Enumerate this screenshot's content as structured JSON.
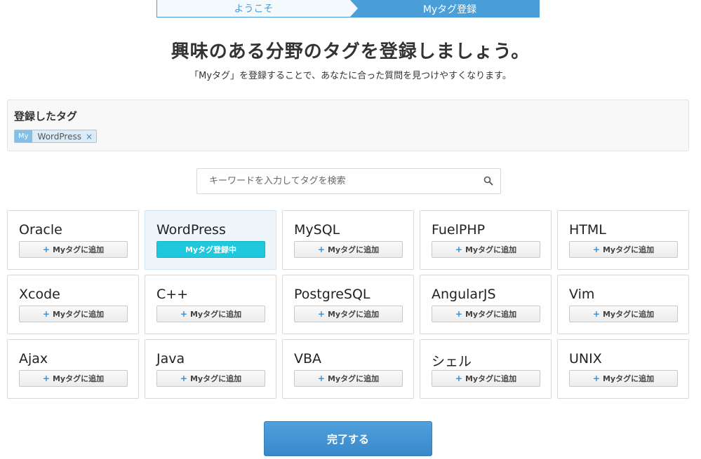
{
  "stepper": {
    "steps": [
      {
        "label": "ようこそ",
        "state": "done"
      },
      {
        "label": "Myタグ登録",
        "state": "current"
      }
    ]
  },
  "header": {
    "title": "興味のある分野のタグを登録しましょう。",
    "subtitle": "「Myタグ」を登録することで、あなたに合った質問を見つけやすくなります。"
  },
  "registered_tags": {
    "title": "登録したタグ",
    "items": [
      {
        "prefix": "My",
        "label": "WordPress",
        "remove": "×"
      }
    ]
  },
  "search": {
    "placeholder": "キーワードを入力してタグを検索",
    "value": "",
    "icon": "search-icon"
  },
  "tags": [
    {
      "name": "Oracle",
      "button": "Myタグに追加",
      "registered": false
    },
    {
      "name": "WordPress",
      "button": "Myタグ登録中",
      "registered": true
    },
    {
      "name": "MySQL",
      "button": "Myタグに追加",
      "registered": false
    },
    {
      "name": "FuelPHP",
      "button": "Myタグに追加",
      "registered": false
    },
    {
      "name": "HTML",
      "button": "Myタグに追加",
      "registered": false
    },
    {
      "name": "Xcode",
      "button": "Myタグに追加",
      "registered": false
    },
    {
      "name": "C++",
      "button": "Myタグに追加",
      "registered": false
    },
    {
      "name": "PostgreSQL",
      "button": "Myタグに追加",
      "registered": false
    },
    {
      "name": "AngularJS",
      "button": "Myタグに追加",
      "registered": false
    },
    {
      "name": "Vim",
      "button": "Myタグに追加",
      "registered": false
    },
    {
      "name": "Ajax",
      "button": "Myタグに追加",
      "registered": false
    },
    {
      "name": "Java",
      "button": "Myタグに追加",
      "registered": false
    },
    {
      "name": "VBA",
      "button": "Myタグに追加",
      "registered": false
    },
    {
      "name": "シェル",
      "button": "Myタグに追加",
      "registered": false
    },
    {
      "name": "UNIX",
      "button": "Myタグに追加",
      "registered": false
    }
  ],
  "footer": {
    "complete_label": "完了する"
  },
  "colors": {
    "accent": "#4a9fd8",
    "registered_button": "#1fc8dc",
    "plus": "#3a8fd0"
  }
}
